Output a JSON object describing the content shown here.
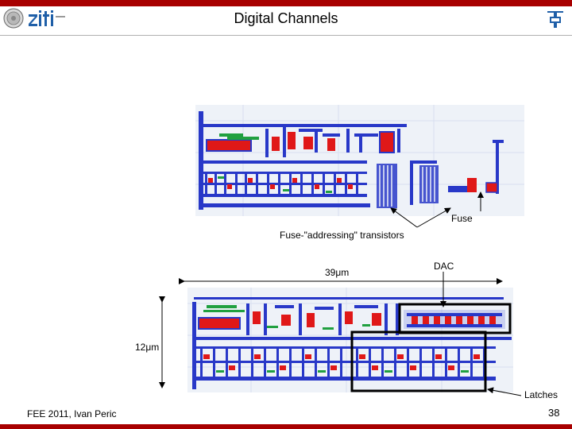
{
  "slide": {
    "title": "Digital Channels",
    "footer": "FEE 2011, Ivan Peric",
    "page_number": "38"
  },
  "labels": {
    "fuse": "Fuse",
    "fuse_addressing": "Fuse-\"addressing\" transistors",
    "width_dim": "39μm",
    "dac": "DAC",
    "height_dim": "12μm",
    "latches": "Latches"
  },
  "logos": {
    "left_seal": "university-seal-icon",
    "left_wordmark": "ziti",
    "right_logo": "institute-logo-icon"
  },
  "colors": {
    "accent_bar": "#a80000",
    "metal_blue": "#2838c8",
    "poly_red": "#e01818",
    "green": "#20a040"
  }
}
